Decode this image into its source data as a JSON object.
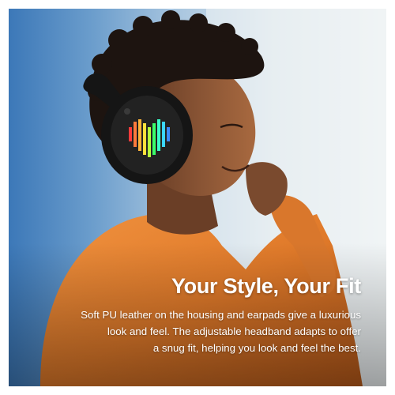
{
  "headline": "Your Style, Your Fit",
  "description_lines": [
    "Soft PU leather on the housing and earpads give a luxurious",
    "look and feel. The adjustable headband adapts to offer",
    "a snug fit, helping you look and feel the best."
  ],
  "colors": {
    "headline_text": "#ffffff",
    "body_text": "#ffffff",
    "wall_blue": "#3c78b8",
    "sweater_orange": "#e07a2a",
    "headphones": "#151515"
  }
}
